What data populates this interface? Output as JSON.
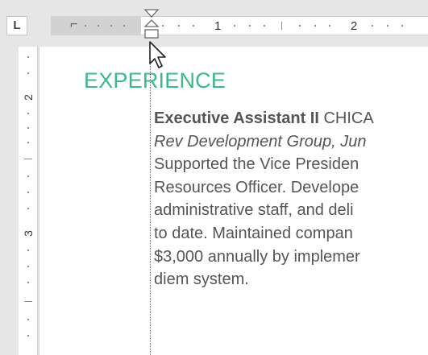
{
  "ruler": {
    "tab_selector_icon": "left-tab-stop-icon",
    "tab_selector_glyph": "L",
    "first_line_marker_glyph": "⌐",
    "numbers": [
      "1",
      "2"
    ]
  },
  "vertical_ruler": {
    "numbers": [
      "2",
      "3"
    ]
  },
  "document": {
    "heading": "EXPERIENCE",
    "job_title": "Executive Assistant II",
    "location": " CHICA",
    "line2": "Rev Development Group, Jun",
    "lines": [
      "Supported the Vice Presiden",
      "Resources Officer. Develope",
      "administrative staff, and deli",
      "to date. Maintained compan",
      "$3,000 annually by implemer",
      "diem system."
    ]
  },
  "colors": {
    "heading": "#3cb98a",
    "body_text": "#555555",
    "ruler_background": "#e6e6e6"
  },
  "pointer": "arrow-cursor-icon"
}
